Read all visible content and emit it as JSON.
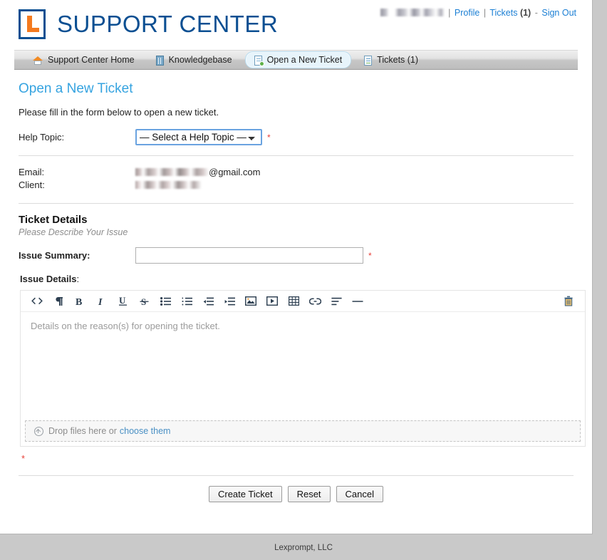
{
  "header": {
    "logo_text": "SUPPORT CENTER",
    "logo_icon": "letter-l-logo-icon",
    "userbar": {
      "username_redacted": "",
      "profile": "Profile",
      "tickets": "Tickets",
      "tickets_count": "(1)",
      "sign_out": "Sign Out",
      "separator": "|",
      "dash": "-"
    }
  },
  "nav": {
    "items": [
      {
        "label": "Support Center Home",
        "icon": "home-icon",
        "active": false
      },
      {
        "label": "Knowledgebase",
        "icon": "book-icon",
        "active": false
      },
      {
        "label": "Open a New Ticket",
        "icon": "new-page-icon",
        "active": true
      },
      {
        "label": "Tickets (1)",
        "icon": "page-icon",
        "active": false
      }
    ]
  },
  "main": {
    "page_title": "Open a New Ticket",
    "intro": "Please fill in the form below to open a new ticket.",
    "help_topic": {
      "label": "Help Topic:",
      "selected": "— Select a Help Topic —",
      "options": [
        "— Select a Help Topic —"
      ],
      "required_marker": "*"
    },
    "user_info": {
      "email_label": "Email:",
      "email_domain": "@gmail.com",
      "client_label": "Client:"
    },
    "ticket_details": {
      "section_title": "Ticket Details",
      "section_subtitle": "Please Describe Your Issue",
      "summary_label": "Issue Summary:",
      "summary_value": "",
      "summary_required": "*",
      "details_label": "Issue Details",
      "details_colon": ":",
      "editor_placeholder": "Details on the reason(s) for opening the ticket.",
      "bottom_required": "*"
    },
    "toolbar": {
      "buttons": [
        {
          "name": "code-icon",
          "title": "Code"
        },
        {
          "name": "paragraph-icon",
          "title": "Paragraph"
        },
        {
          "name": "bold-icon",
          "title": "Bold"
        },
        {
          "name": "italic-icon",
          "title": "Italic"
        },
        {
          "name": "underline-icon",
          "title": "Underline"
        },
        {
          "name": "strikethrough-icon",
          "title": "Strikethrough"
        },
        {
          "name": "bullet-list-icon",
          "title": "Bullet list"
        },
        {
          "name": "numbered-list-icon",
          "title": "Numbered list"
        },
        {
          "name": "outdent-icon",
          "title": "Outdent"
        },
        {
          "name": "indent-icon",
          "title": "Indent"
        },
        {
          "name": "image-icon",
          "title": "Insert image"
        },
        {
          "name": "video-icon",
          "title": "Insert video"
        },
        {
          "name": "table-icon",
          "title": "Insert table"
        },
        {
          "name": "link-icon",
          "title": "Insert link"
        },
        {
          "name": "align-icon",
          "title": "Align"
        },
        {
          "name": "horizontal-rule-icon",
          "title": "Horizontal rule"
        }
      ],
      "trash": {
        "name": "trash-icon",
        "title": "Delete"
      }
    },
    "dropzone": {
      "text_before": "Drop files here or",
      "link_text": "choose them",
      "icon": "upload-circle-icon"
    },
    "actions": {
      "create": "Create Ticket",
      "reset": "Reset",
      "cancel": "Cancel"
    }
  },
  "footer": {
    "text": "Lexprompt, LLC"
  },
  "colors": {
    "brand_blue": "#0b4f92",
    "logo_orange": "#f47a1f",
    "title_blue": "#35a3e0",
    "link_blue": "#1b7fd4",
    "required_red": "#e8413a",
    "page_bg": "#c9c9c9"
  }
}
